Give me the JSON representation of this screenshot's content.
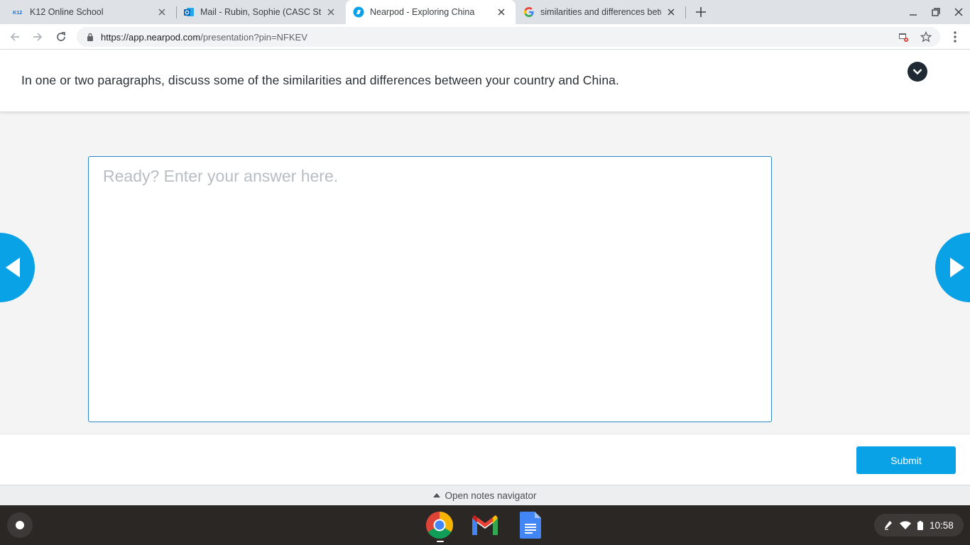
{
  "browser": {
    "tabs": [
      {
        "title": "K12 Online School",
        "icon": "k12-logo-icon",
        "active": false
      },
      {
        "title": "Mail - Rubin, Sophie (CASC Stude",
        "icon": "outlook-icon",
        "active": false
      },
      {
        "title": "Nearpod - Exploring China",
        "icon": "nearpod-icon",
        "active": true
      },
      {
        "title": "similarities and differences betw",
        "icon": "google-icon",
        "active": false
      }
    ],
    "k12_logo_text": "K12",
    "url_host": "https://app.nearpod.com",
    "url_path": "/presentation?pin=NFKEV"
  },
  "question": {
    "text": "In one or two paragraphs, discuss some of the similarities and differences between your country and China."
  },
  "answer": {
    "placeholder": "Ready? Enter your answer here.",
    "value": ""
  },
  "footer": {
    "submit_label": "Submit",
    "notes_label": "Open notes navigator"
  },
  "shelf": {
    "apps": [
      "chrome-icon",
      "gmail-icon",
      "docs-icon"
    ],
    "time": "10:58"
  },
  "colors": {
    "accent": "#0aa2e6",
    "textbox_border": "#2b86c5",
    "shelf": "#2b2725"
  }
}
